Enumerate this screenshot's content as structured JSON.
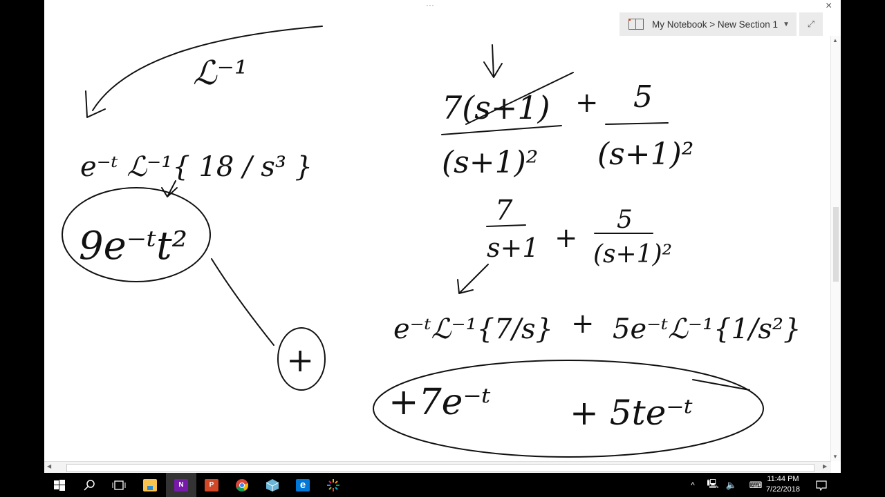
{
  "header": {
    "breadcrumb": "My Notebook > New Section 1",
    "more": "···",
    "close": "×",
    "expand": "⤢"
  },
  "ink": {
    "inverse_laplace": "ℒ⁻¹",
    "left_expr": "e⁻ᵗ ℒ⁻¹{ 18 / s³ }",
    "left_result": "9e⁻ᵗt²",
    "circled": "+",
    "top_frac_num": "7(s+1)",
    "top_frac_den": "(s+1)²",
    "plus": "+",
    "top_frac2_num": "5",
    "top_frac2_den": "(s+1)²",
    "mid_frac1_num": "7",
    "mid_frac1_den": "s+1",
    "mid_frac2_num": "5",
    "mid_frac2_den": "(s+1)²",
    "lap_term1": "e⁻ᵗℒ⁻¹{7/s}",
    "lap_term2": "5e⁻ᵗℒ⁻¹{1/s²}",
    "final1": "+7e⁻ᵗ",
    "final2": "+ 5te⁻ᵗ"
  },
  "taskbar": {
    "apps": [
      {
        "name": "start",
        "icon": "windows-icon"
      },
      {
        "name": "search",
        "icon": "search-icon"
      },
      {
        "name": "task-view",
        "icon": "task-view-icon"
      },
      {
        "name": "file-explorer",
        "icon": "folder-icon"
      },
      {
        "name": "onenote",
        "icon": "onenote-icon",
        "label": "N"
      },
      {
        "name": "powerpoint",
        "icon": "powerpoint-icon",
        "label": "P"
      },
      {
        "name": "chrome",
        "icon": "chrome-icon"
      },
      {
        "name": "3d-app",
        "icon": "cube-icon"
      },
      {
        "name": "edge",
        "icon": "edge-icon",
        "label": "e"
      },
      {
        "name": "app",
        "icon": "burst-icon"
      }
    ],
    "time": "11:44 PM",
    "date": "7/22/2018"
  },
  "colors": {
    "onenote": "#7719aa",
    "powerpoint": "#d24726",
    "edge": "#0078d7",
    "folder": "#f8c44f"
  }
}
